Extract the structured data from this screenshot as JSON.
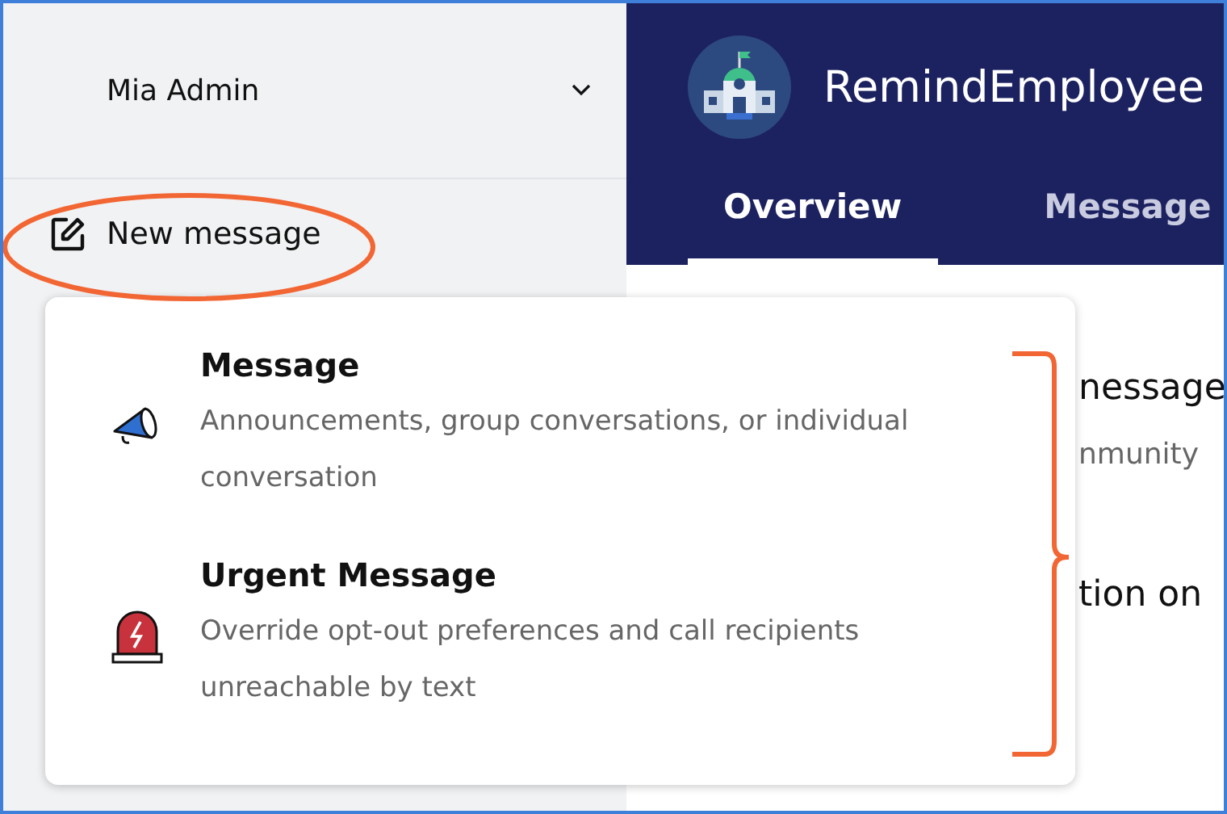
{
  "sidebar": {
    "user": {
      "name": "Mia Admin"
    },
    "new_message": {
      "label": "New message"
    }
  },
  "header": {
    "title": "RemindEmployee",
    "tabs": [
      {
        "label": "Overview",
        "selected": true
      },
      {
        "label": "Message",
        "selected": false
      }
    ]
  },
  "content": {
    "lines": [
      {
        "text": "nessage",
        "kind": "heading"
      },
      {
        "text": "nmunity",
        "kind": "body"
      },
      {
        "text": "tion on",
        "kind": "heading"
      }
    ]
  },
  "menu": {
    "items": [
      {
        "kind": "message",
        "title": "Message",
        "description": "Announcements, group conversations, or individual conversation"
      },
      {
        "kind": "urgent",
        "title": "Urgent Message",
        "description": "Override opt-out preferences and call recipients unreachable by text"
      }
    ]
  }
}
